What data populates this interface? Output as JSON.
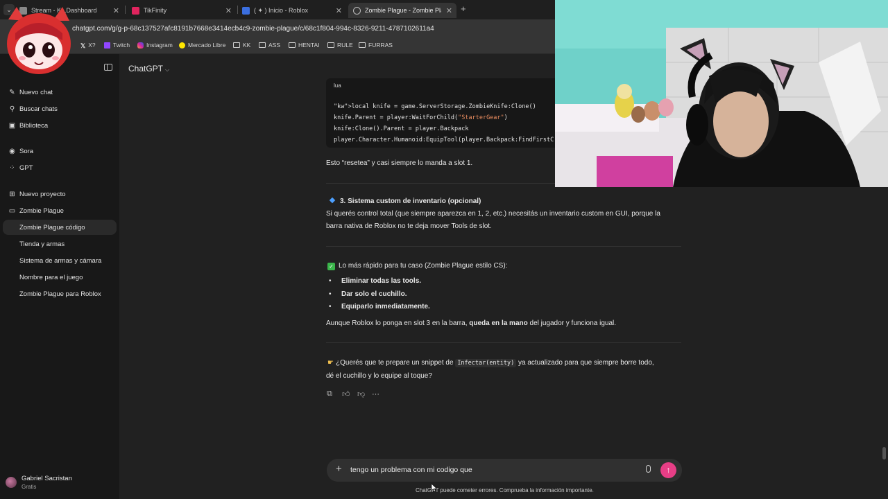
{
  "browser": {
    "tabs": [
      {
        "label": "Stream - Kick Dashboard",
        "display": "Stream - K...Dashboard",
        "icon_color": "#888888"
      },
      {
        "label": "TikFinity",
        "icon_color": "#e0245e"
      },
      {
        "label": "( ✦ ) Inicio - Roblox",
        "icon_color": "#3b6fe0"
      },
      {
        "label": "Zombie Plague - Zombie Plag",
        "icon_color": "#bdbdbd"
      }
    ],
    "url": "chatgpt.com/g/g-p-68c137527afc8191b7668e3414ecb4c9-zombie-plague/c/68c1f804-994c-8326-9211-4787102611a4",
    "bookmarks": [
      {
        "label": "X?",
        "icon": "x-icon"
      },
      {
        "label": "Twitch",
        "icon": "twitch-icon"
      },
      {
        "label": "Instagram",
        "icon": "instagram-icon"
      },
      {
        "label": "Mercado Libre",
        "icon": "mercadolibre-icon"
      },
      {
        "label": "KK",
        "icon": "folder-icon"
      },
      {
        "label": "ASS",
        "icon": "folder-icon"
      },
      {
        "label": "HENTAI",
        "icon": "folder-icon"
      },
      {
        "label": "RULE",
        "icon": "folder-icon"
      },
      {
        "label": "FURRAS",
        "icon": "folder-icon"
      }
    ]
  },
  "sidebar": {
    "nav": [
      {
        "label": "Nuevo chat",
        "icon": "compose-icon"
      },
      {
        "label": "Buscar chats",
        "icon": "search-icon"
      },
      {
        "label": "Biblioteca",
        "icon": "library-icon"
      },
      {
        "label": "Sora",
        "icon": "sora-icon"
      },
      {
        "label": "GPT",
        "icon": "gpt-grid-icon"
      },
      {
        "label": "Nuevo proyecto",
        "icon": "new-folder-icon"
      },
      {
        "label": "Zombie Plague",
        "icon": "folder-icon"
      }
    ],
    "project_chats": [
      "Zombie Plague código",
      "Tienda y armas",
      "Sistema de armas y cámara",
      "Nombre para el juego",
      "Zombie Plague para Roblox"
    ],
    "user": {
      "name": "Gabriel Sacristan",
      "plan": "Gratis"
    }
  },
  "header": {
    "model": "ChatGPT",
    "chevron": "⌵"
  },
  "message": {
    "code": {
      "lang": "lua",
      "lines": [
        "local knife = game.ServerStorage.ZombieKnife:Clone()",
        "knife.Parent = player:WaitForChild(\"StarterGear\")",
        "knife:Clone().Parent = player.Backpack",
        "player.Character.Humanoid:EquipTool(player.Backpack:FindFirstC"
      ]
    },
    "after_code": "Esto “resetea” y casi siempre lo manda a slot 1.",
    "section3_title": "3. Sistema custom de inventario (opcional)",
    "section3_line1": "Si querés control total (que siempre aparezca en 1, 2, etc.) necesitás un inventario custom en GUI, porque la",
    "section3_line2": "barra nativa de Roblox no te deja mover Tools de slot.",
    "fast_title": "Lo más rápido para tu caso (Zombie Plague estilo CS):",
    "bullets": [
      "Eliminar todas las tools.",
      "Dar solo el cuchillo.",
      "Equiparlo inmediatamente."
    ],
    "summary_before": "Aunque Roblox lo ponga en slot 3 en la barra, ",
    "summary_bold": "queda en la mano",
    "summary_after": " del jugador y funciona igual.",
    "offer_before": "¿Querés que te prepare un snippet de ",
    "offer_code": "Infectar(entity)",
    "offer_after": " ya actualizado para que siempre borre todo,",
    "offer_line2": "dé el cuchillo y lo equipe al toque?"
  },
  "composer": {
    "text": "tengo un problema con mi codigo que",
    "disclaimer": "ChatGPT puede cometer errores. Comprueba la información importante."
  }
}
